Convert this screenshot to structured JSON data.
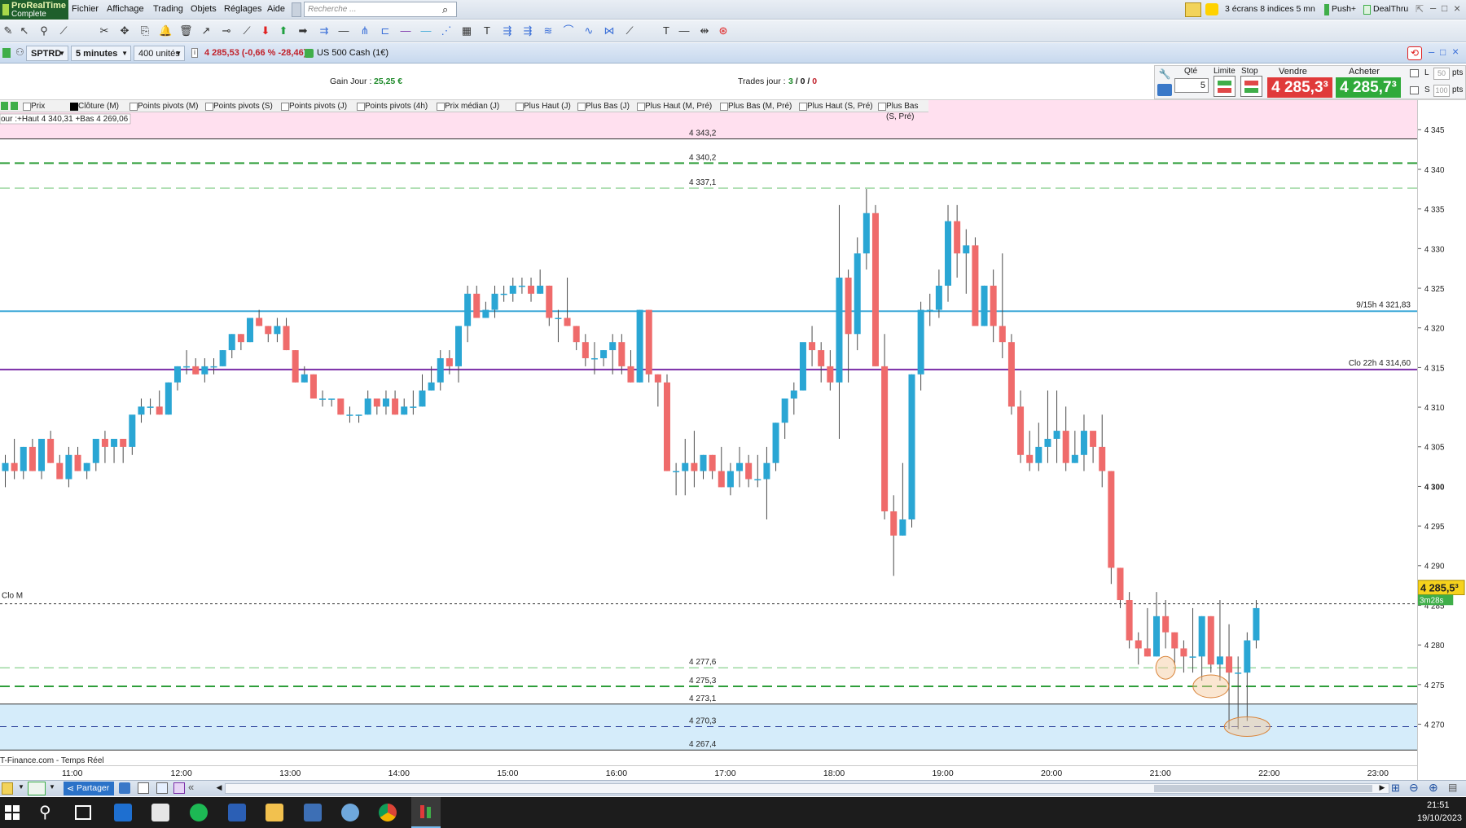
{
  "app": {
    "logo_line1": "ProRealTime",
    "logo_line2": "Complete"
  },
  "menu": [
    "Fichier",
    "Affichage",
    "Trading",
    "Objets",
    "Réglages",
    "Aide"
  ],
  "search": {
    "placeholder": "Recherche ..."
  },
  "right_menu": {
    "layout": "3 écrans 8 indices 5 mn",
    "push": "Push+",
    "dealthru": "DealThru"
  },
  "instrument": {
    "ticker": "SPTRD",
    "timeframe": "5 minutes",
    "units": "400 unités",
    "price_change": "4 285,53 (-0,66 % -28,46)",
    "name": "US 500 Cash (1€)"
  },
  "info": {
    "gain_label": "Gain Jour :",
    "gain_value": "25,25 €",
    "trades_label": "Trades jour :",
    "trades_win": "3",
    "trades_sep1": "/",
    "trades_mid": "0",
    "trades_sep2": "/",
    "trades_loss": "0"
  },
  "order_panel": {
    "qty_label": "Qté",
    "qty_value": "5",
    "limit_label": "Limite",
    "stop_label": "Stop",
    "sell_label": "Vendre",
    "sell_price": "4 285,3³",
    "buy_label": "Acheter",
    "buy_price": "4 285,7³",
    "l_label": "L",
    "l_pts": "50",
    "s_label": "S",
    "s_pts": "100",
    "pts_label": "pts"
  },
  "indicators": [
    {
      "label": "Prix",
      "checked": false
    },
    {
      "label": "Clôture (M)",
      "checked": true
    },
    {
      "label": "Points pivots (M)",
      "checked": false
    },
    {
      "label": "Points pivots (S)",
      "checked": false
    },
    {
      "label": "Points pivots (J)",
      "checked": false
    },
    {
      "label": "Points pivots (4h)",
      "checked": false
    },
    {
      "label": "Prix médian (J)",
      "checked": false
    },
    {
      "label": "Plus Haut (J)",
      "checked": false
    },
    {
      "label": "Plus Bas (J)",
      "checked": false
    },
    {
      "label": "Plus Haut (M, Pré)",
      "checked": false
    },
    {
      "label": "Plus Bas (M, Pré)",
      "checked": false
    },
    {
      "label": "Plus Haut (S, Pré)",
      "checked": false
    },
    {
      "label": "Plus Bas (S, Pré)",
      "checked": false
    }
  ],
  "chart_data": {
    "type": "candlestick",
    "timeframe": "5 minutes",
    "ylim": [
      4265.5,
      4346.5
    ],
    "y_ticks": [
      "4 345",
      "4 340",
      "4 335",
      "4 330",
      "4 325",
      "4 320",
      "4 315",
      "4 310",
      "4 305",
      "4 300",
      "4 295",
      "4 290",
      "4 285",
      "4 280",
      "4 275",
      "4 270"
    ],
    "y_tick_values": [
      4345,
      4340,
      4335,
      4330,
      4325,
      4320,
      4315,
      4310,
      4305,
      4300,
      4295,
      4290,
      4285,
      4280,
      4275,
      4270
    ],
    "x_ticks": [
      "11:00",
      "12:00",
      "13:00",
      "14:00",
      "15:00",
      "16:00",
      "17:00",
      "18:00",
      "19:00",
      "20:00",
      "21:00",
      "22:00",
      "23:00"
    ],
    "x_tick_index": [
      7.5,
      19.5,
      31.5,
      43.5,
      55.5,
      67.5,
      79.5,
      91.5,
      103.5,
      115.5,
      127.5,
      139.5,
      151.5
    ],
    "highlow_label": "our :+Haut 4 340,31 +Bas 4 269,06",
    "source_label": "T-Finance.com - Temps Réel",
    "last_price": "4 285,5³",
    "countdown": "3m28s",
    "last_price_value": 4285.53,
    "levels": [
      {
        "value": 4343.2,
        "label": "4 343,2",
        "style": "solid-dark"
      },
      {
        "value": 4340.2,
        "label": "4 340,2",
        "style": "dash-green"
      },
      {
        "value": 4337.1,
        "label": "4 337,1",
        "style": "dash-lightgreen"
      },
      {
        "value": 4277.6,
        "label": "4 277,6",
        "style": "dash-lightgreen"
      },
      {
        "value": 4275.3,
        "label": "4 275,3",
        "style": "dash-green"
      },
      {
        "value": 4273.1,
        "label": "4 273,1",
        "style": "solid-dark"
      },
      {
        "value": 4270.3,
        "label": "4 270,3",
        "style": "dash-blue"
      },
      {
        "value": 4267.4,
        "label": "4 267,4",
        "style": "solid-dark"
      }
    ],
    "named_lines": [
      {
        "value": 4321.83,
        "label": "9/15h 4 321,83",
        "color": "#3fa9d8"
      },
      {
        "value": 4314.6,
        "label": "Clo 22h 4 314,60",
        "color": "#7b2fa8"
      }
    ],
    "clo_m_label": "Clo M",
    "colors": {
      "up": "#2aa6d4",
      "down": "#ef6b6b",
      "wick": "#4a4a4a",
      "zone_top": "#ffe0ef",
      "zone_bottom": "#d5ecfa"
    },
    "candles": [
      [
        4302,
        4304,
        4300,
        4303
      ],
      [
        4303,
        4306,
        4301,
        4302
      ],
      [
        4302,
        4305,
        4301,
        4305
      ],
      [
        4305,
        4306,
        4302,
        4302
      ],
      [
        4302,
        4306,
        4301,
        4306
      ],
      [
        4306,
        4307,
        4303,
        4303
      ],
      [
        4303,
        4304,
        4301,
        4301
      ],
      [
        4301,
        4305,
        4300,
        4304
      ],
      [
        4304,
        4305,
        4302,
        4302
      ],
      [
        4302,
        4303,
        4301,
        4303
      ],
      [
        4303,
        4306,
        4302,
        4306
      ],
      [
        4306,
        4307,
        4303,
        4305
      ],
      [
        4305,
        4306,
        4303,
        4306
      ],
      [
        4306,
        4306,
        4303,
        4305
      ],
      [
        4305,
        4308,
        4304,
        4309
      ],
      [
        4309,
        4311,
        4308,
        4310
      ],
      [
        4310,
        4311,
        4309,
        4310
      ],
      [
        4310,
        4312,
        4309,
        4309
      ],
      [
        4309,
        4313,
        4309,
        4313
      ],
      [
        4313,
        4315,
        4312,
        4315
      ],
      [
        4315,
        4317,
        4314,
        4315
      ],
      [
        4315,
        4316,
        4314,
        4314
      ],
      [
        4314,
        4316,
        4313,
        4315
      ],
      [
        4315,
        4316,
        4314,
        4315
      ],
      [
        4315,
        4317,
        4315,
        4317
      ],
      [
        4317,
        4319,
        4316,
        4319
      ],
      [
        4319,
        4319,
        4317,
        4318
      ],
      [
        4318,
        4320,
        4318,
        4321
      ],
      [
        4321,
        4322,
        4320,
        4320
      ],
      [
        4320,
        4320,
        4318,
        4319
      ],
      [
        4319,
        4321,
        4318,
        4320
      ],
      [
        4320,
        4321,
        4317,
        4317
      ],
      [
        4317,
        4317,
        4313,
        4313
      ],
      [
        4313,
        4315,
        4313,
        4314
      ],
      [
        4314,
        4314,
        4311,
        4311
      ],
      [
        4311,
        4312,
        4310,
        4311
      ],
      [
        4311,
        4311,
        4310,
        4311
      ],
      [
        4311,
        4311,
        4309,
        4309
      ],
      [
        4309,
        4310,
        4308,
        4309
      ],
      [
        4309,
        4309,
        4308,
        4309
      ],
      [
        4309,
        4312,
        4309,
        4311
      ],
      [
        4311,
        4311,
        4309,
        4310
      ],
      [
        4310,
        4312,
        4309,
        4311
      ],
      [
        4311,
        4312,
        4309,
        4309
      ],
      [
        4309,
        4311,
        4309,
        4310
      ],
      [
        4310,
        4312,
        4309,
        4310
      ],
      [
        4310,
        4314,
        4310,
        4312
      ],
      [
        4312,
        4315,
        4312,
        4313
      ],
      [
        4313,
        4317,
        4312,
        4316
      ],
      [
        4316,
        4317,
        4314,
        4315
      ],
      [
        4315,
        4320,
        4313,
        4320
      ],
      [
        4320,
        4325,
        4318,
        4324
      ],
      [
        4324,
        4325,
        4321,
        4321
      ],
      [
        4321,
        4323,
        4321,
        4322
      ],
      [
        4322,
        4325,
        4321,
        4324
      ],
      [
        4324,
        4325,
        4323,
        4324
      ],
      [
        4324,
        4326,
        4323,
        4325
      ],
      [
        4325,
        4326,
        4324,
        4325
      ],
      [
        4325,
        4326,
        4323,
        4324
      ],
      [
        4324,
        4327,
        4324,
        4325
      ],
      [
        4325,
        4325,
        4320,
        4321
      ],
      [
        4321,
        4322,
        4318,
        4321
      ],
      [
        4321,
        4326,
        4320,
        4320
      ],
      [
        4320,
        4320,
        4317,
        4318
      ],
      [
        4318,
        4319,
        4315,
        4316
      ],
      [
        4316,
        4318,
        4314,
        4316
      ],
      [
        4316,
        4317,
        4315,
        4317
      ],
      [
        4317,
        4319,
        4314,
        4318
      ],
      [
        4318,
        4319,
        4314,
        4315
      ],
      [
        4315,
        4317,
        4313,
        4313
      ],
      [
        4313,
        4322,
        4313,
        4322
      ],
      [
        4322,
        4322,
        4313,
        4314
      ],
      [
        4314,
        4314,
        4310,
        4313
      ],
      [
        4313,
        4314,
        4302,
        4302
      ],
      [
        4302,
        4303,
        4299,
        4302
      ],
      [
        4302,
        4306,
        4299,
        4303
      ],
      [
        4303,
        4307,
        4300,
        4302
      ],
      [
        4302,
        4304,
        4301,
        4304
      ],
      [
        4304,
        4304,
        4301,
        4302
      ],
      [
        4302,
        4305,
        4300,
        4300
      ],
      [
        4300,
        4303,
        4299,
        4302
      ],
      [
        4302,
        4305,
        4300,
        4303
      ],
      [
        4303,
        4304,
        4300,
        4301
      ],
      [
        4301,
        4304,
        4300,
        4301
      ],
      [
        4301,
        4305,
        4296,
        4303
      ],
      [
        4303,
        4308,
        4302,
        4308
      ],
      [
        4308,
        4311,
        4306,
        4311
      ],
      [
        4311,
        4313,
        4309,
        4312
      ],
      [
        4312,
        4315,
        4312,
        4318
      ],
      [
        4318,
        4320,
        4315,
        4317
      ],
      [
        4317,
        4318,
        4313,
        4315
      ],
      [
        4315,
        4317,
        4312,
        4313
      ],
      [
        4313,
        4335,
        4306,
        4326
      ],
      [
        4326,
        4327,
        4313,
        4319
      ],
      [
        4319,
        4331,
        4317,
        4329
      ],
      [
        4329,
        4337,
        4327,
        4334
      ],
      [
        4334,
        4335,
        4315,
        4315
      ],
      [
        4315,
        4319,
        4296,
        4297
      ],
      [
        4297,
        4299,
        4289,
        4294
      ],
      [
        4294,
        4303,
        4294,
        4296
      ],
      [
        4296,
        4314,
        4295,
        4314
      ],
      [
        4314,
        4323,
        4312,
        4322
      ],
      [
        4322,
        4324,
        4320,
        4322
      ],
      [
        4322,
        4327,
        4321,
        4325
      ],
      [
        4325,
        4335,
        4323,
        4333
      ],
      [
        4333,
        4335,
        4326,
        4329
      ],
      [
        4329,
        4332,
        4324,
        4330
      ],
      [
        4330,
        4331,
        4321,
        4320
      ],
      [
        4320,
        4325,
        4320,
        4325
      ],
      [
        4325,
        4327,
        4318,
        4320
      ],
      [
        4320,
        4329,
        4316,
        4318
      ],
      [
        4318,
        4319,
        4309,
        4310
      ],
      [
        4310,
        4312,
        4303,
        4304
      ],
      [
        4304,
        4307,
        4302,
        4303
      ],
      [
        4303,
        4308,
        4302,
        4305
      ],
      [
        4305,
        4312,
        4303,
        4306
      ],
      [
        4306,
        4312,
        4303,
        4307
      ],
      [
        4307,
        4310,
        4302,
        4303
      ],
      [
        4303,
        4307,
        4303,
        4304
      ],
      [
        4304,
        4309,
        4302,
        4307
      ],
      [
        4307,
        4306,
        4303,
        4305
      ],
      [
        4305,
        4309,
        4300,
        4302
      ],
      [
        4302,
        4302,
        4288,
        4290
      ],
      [
        4290,
        4290,
        4285,
        4286
      ],
      [
        4286,
        4287,
        4280,
        4281
      ],
      [
        4281,
        4282,
        4278,
        4280
      ],
      [
        4280,
        4285,
        4279,
        4279
      ],
      [
        4279,
        4287,
        4279,
        4284
      ],
      [
        4284,
        4286,
        4280,
        4282
      ],
      [
        4282,
        4282,
        4278,
        4280
      ],
      [
        4280,
        4281,
        4277,
        4279
      ],
      [
        4279,
        4285,
        4277,
        4279
      ],
      [
        4279,
        4284,
        4276,
        4284
      ],
      [
        4284,
        4284,
        4277,
        4278
      ],
      [
        4278,
        4286,
        4276,
        4279
      ],
      [
        4279,
        4283,
        4270,
        4277
      ],
      [
        4277,
        4279,
        4270,
        4277
      ],
      [
        4277,
        4282,
        4271,
        4281
      ],
      [
        4281,
        4286,
        4280,
        4285
      ]
    ]
  }
}
